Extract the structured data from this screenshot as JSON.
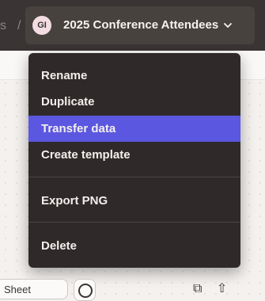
{
  "breadcrumb": {
    "previous_fragment": "s",
    "separator": "/",
    "avatar_initials": "GI",
    "current": "2025 Conference Attendees"
  },
  "menu": {
    "items": [
      {
        "label": "Rename"
      },
      {
        "label": "Duplicate"
      },
      {
        "label": "Transfer data",
        "highlighted": true
      },
      {
        "label": "Create template"
      },
      {
        "label": "Export PNG"
      },
      {
        "label": "Delete"
      }
    ]
  },
  "bottom_toolbar": {
    "sheet_label": "Sheet",
    "icons": [
      "circle-icon",
      "copy-icon",
      "up-arrow-icon"
    ]
  },
  "colors": {
    "topbar": "#3a3534",
    "menu_bg": "#2f2a29",
    "highlight": "#5b57e0"
  }
}
